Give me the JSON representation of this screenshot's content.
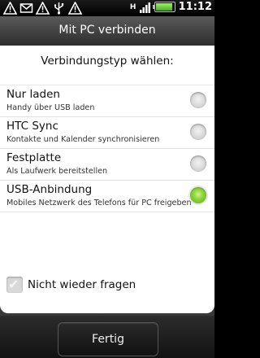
{
  "status_bar": {
    "notification_icons": [
      "warning-icon",
      "gmail-icon",
      "warning-icon",
      "usb-icon",
      "warning-icon"
    ],
    "network_type": "H",
    "clock": "11:12"
  },
  "dialog": {
    "title": "Mit PC verbinden",
    "prompt": "Verbindungstyp wählen:",
    "options": [
      {
        "title": "Nur laden",
        "subtitle": "Handy über USB laden",
        "selected": false
      },
      {
        "title": "HTC Sync",
        "subtitle": "Kontakte und Kalender synchronisieren",
        "selected": false
      },
      {
        "title": "Festplatte",
        "subtitle": "Als Laufwerk bereitstellen",
        "selected": false
      },
      {
        "title": "USB-Anbindung",
        "subtitle": "Mobiles Netzwerk des Telefons für PC freigeben",
        "selected": true
      }
    ],
    "dont_ask": {
      "label": "Nicht wieder fragen",
      "checked": true
    }
  },
  "buttons": {
    "done": "Fertig"
  },
  "colors": {
    "selected_radio": "#7ac943",
    "title_bar": "#3a3a3a"
  }
}
